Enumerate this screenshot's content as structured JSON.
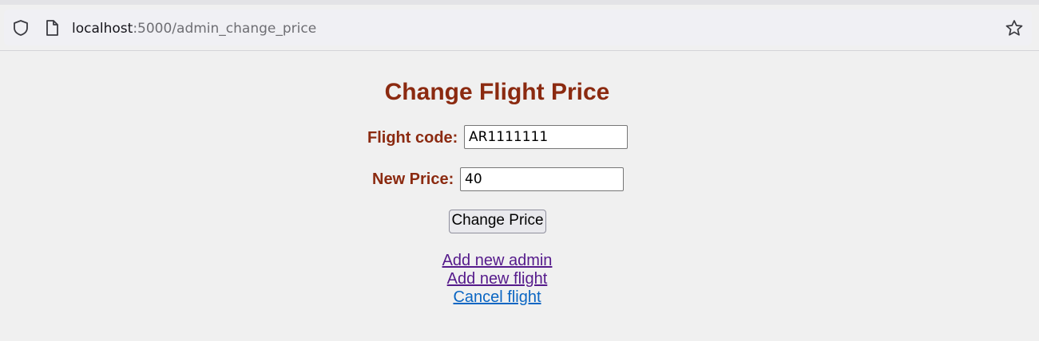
{
  "browser": {
    "url_host": "localhost",
    "url_path": ":5000/admin_change_price",
    "icons": [
      "shield-icon",
      "page-icon",
      "bookmark-star-icon"
    ]
  },
  "page": {
    "title": "Change Flight Price",
    "form": {
      "flight_code_label": "Flight code:",
      "flight_code_value": "AR1111111",
      "new_price_label": "New Price:",
      "new_price_value": "40",
      "submit_label": "Change Price"
    },
    "links": [
      {
        "label": "Add new admin"
      },
      {
        "label": "Add new flight"
      },
      {
        "label": "Cancel flight"
      }
    ]
  },
  "colors": {
    "heading": "#8b2a10",
    "visited_link": "#551a8b",
    "link": "#0b66c3",
    "background": "#f0f0f0"
  }
}
